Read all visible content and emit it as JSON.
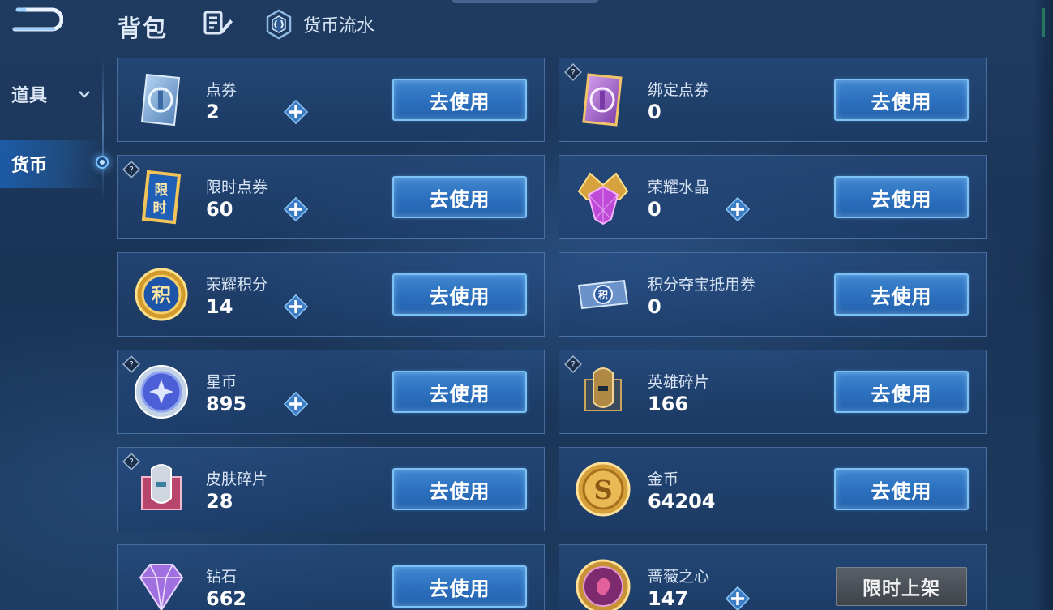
{
  "header": {
    "title": "背包",
    "flow_label": "货币流水"
  },
  "sidebar": {
    "items": [
      {
        "label": "道具"
      },
      {
        "label": "货币"
      }
    ]
  },
  "cards": [
    {
      "name": "点券",
      "count": "2",
      "button": "去使用"
    },
    {
      "name": "绑定点券",
      "count": "0",
      "button": "去使用"
    },
    {
      "name": "限时点券",
      "count": "60",
      "button": "去使用"
    },
    {
      "name": "荣耀水晶",
      "count": "0",
      "button": "去使用"
    },
    {
      "name": "荣耀积分",
      "count": "14",
      "button": "去使用"
    },
    {
      "name": "积分夺宝抵用券",
      "count": "0",
      "button": "去使用"
    },
    {
      "name": "星币",
      "count": "895",
      "button": "去使用"
    },
    {
      "name": "英雄碎片",
      "count": "166",
      "button": "去使用"
    },
    {
      "name": "皮肤碎片",
      "count": "28",
      "button": "去使用"
    },
    {
      "name": "金币",
      "count": "64204",
      "button": "去使用"
    },
    {
      "name": "钻石",
      "count": "662",
      "button": "去使用"
    },
    {
      "name": "蔷薇之心",
      "count": "147",
      "button": "限时上架"
    }
  ],
  "icon_labels": {
    "limited_coupon_glyph": "限时",
    "honor_points_glyph": "积",
    "points_voucher_glyph": "积",
    "gold_glyph": "S"
  },
  "colors": {
    "button_blue": "#2b6fbd",
    "button_border": "#7cc1f4",
    "background": "#1f3b60",
    "limited_button": "#4a5058"
  }
}
